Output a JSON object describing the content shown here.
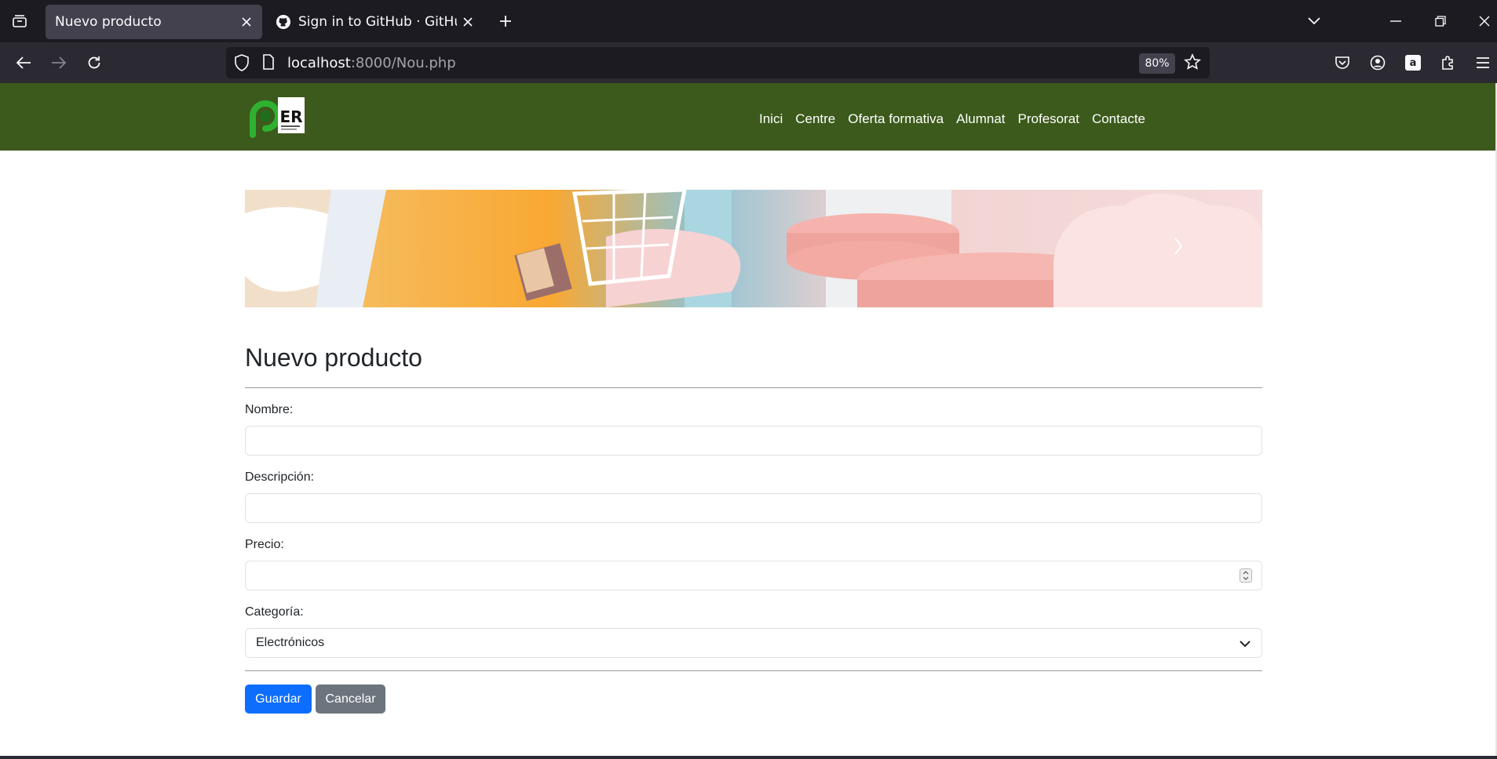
{
  "browser": {
    "tabs": [
      {
        "title": "Nuevo producto",
        "active": true
      },
      {
        "title": "Sign in to GitHub · GitHub",
        "active": false
      }
    ],
    "url_host": "localhost",
    "url_rest": ":8000/Nou.php",
    "zoom": "80%"
  },
  "site": {
    "nav": [
      "Inici",
      "Centre",
      "Oferta formativa",
      "Alumnat",
      "Profesorat",
      "Contacte"
    ],
    "logo_text": "ER",
    "colors": {
      "header_bg": "#3c5a1b",
      "primary": "#0d6efd",
      "secondary": "#6c757d"
    }
  },
  "form": {
    "title": "Nuevo producto",
    "fields": {
      "nombre": {
        "label": "Nombre:",
        "value": ""
      },
      "descripcion": {
        "label": "Descripción:",
        "value": ""
      },
      "precio": {
        "label": "Precio:",
        "value": ""
      },
      "categoria": {
        "label": "Categoría:",
        "selected": "Electrónicos"
      }
    },
    "buttons": {
      "save": "Guardar",
      "cancel": "Cancelar"
    }
  }
}
